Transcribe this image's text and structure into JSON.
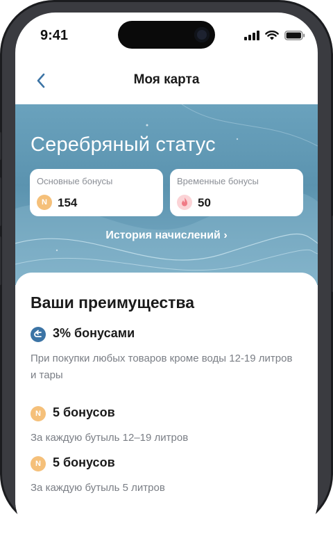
{
  "status_bar": {
    "time": "9:41"
  },
  "navbar": {
    "title": "Моя карта"
  },
  "hero": {
    "status_title": "Серебряный статус",
    "main_bonus": {
      "label": "Основные бонусы",
      "coin_letter": "N",
      "value": "154"
    },
    "temp_bonus": {
      "label": "Временные бонусы",
      "value": "50"
    },
    "history_link": "История начислений ›"
  },
  "benefits": {
    "title": "Ваши преимущества",
    "items": [
      {
        "title": "3% бонусами",
        "desc": "При покупки любых товаров кроме воды 12-19 литров и тары",
        "icon": "return-arrow-icon"
      },
      {
        "title": "5 бонусов",
        "desc": "За каждую бутыль 12–19 литров",
        "icon_letter": "N"
      },
      {
        "title": "5 бонусов",
        "desc": "За каждую бутыль 5 литров",
        "icon_letter": "N"
      }
    ]
  },
  "colors": {
    "accent_blue": "#3c74a5",
    "coin": "#f5c07a",
    "hero_bg": "#5b93af"
  }
}
